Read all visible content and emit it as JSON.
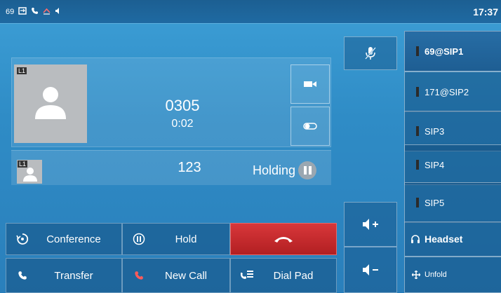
{
  "status_bar": {
    "line_count": "69",
    "time": "17:37"
  },
  "active_call": {
    "number": "0305",
    "duration": "0:02",
    "line_tag": "L1"
  },
  "held_call": {
    "number": "123",
    "status": "Holding",
    "line_tag": "L1"
  },
  "softkeys": {
    "conference": "Conference",
    "hold": "Hold",
    "transfer": "Transfer",
    "new_call": "New Call",
    "dial_pad": "Dial Pad"
  },
  "line_keys": [
    {
      "label": "69@SIP1"
    },
    {
      "label": "171@SIP2"
    },
    {
      "label": "SIP3"
    },
    {
      "label": "SIP4"
    },
    {
      "label": "SIP5"
    },
    {
      "label": "Headset",
      "icon": "headset-icon"
    },
    {
      "label": "Unfold",
      "icon": "unfold-icon"
    }
  ],
  "colors": {
    "background": "#2f8cc6",
    "end_call": "#c42a2d",
    "avatar": "#b9bcbf"
  }
}
